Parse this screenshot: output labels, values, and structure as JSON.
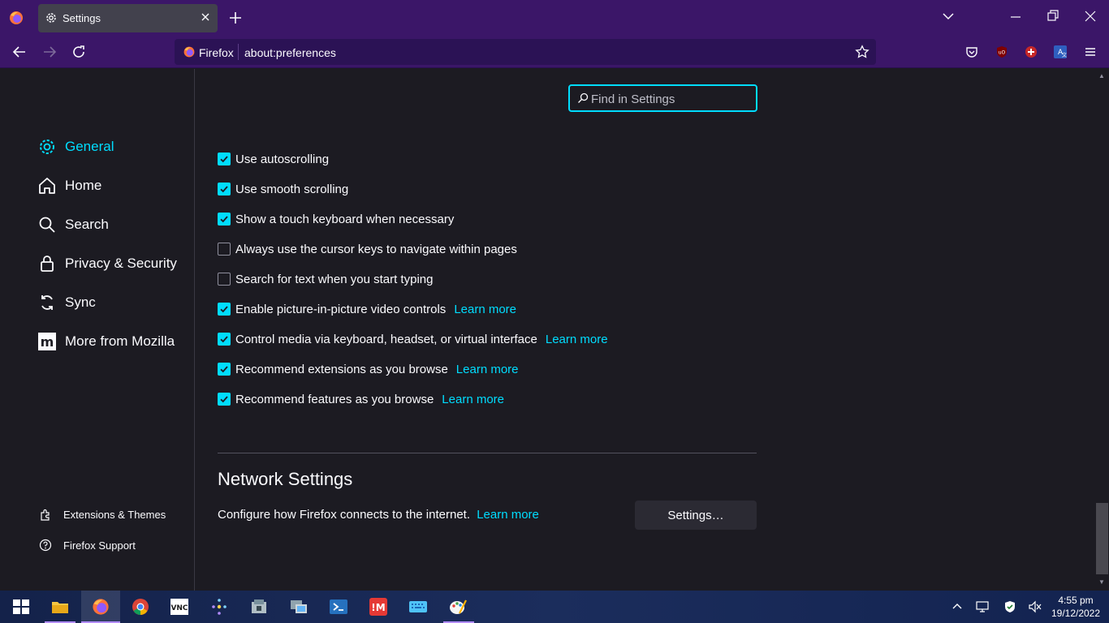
{
  "tab": {
    "title": "Settings"
  },
  "urlbar": {
    "identity": "Firefox",
    "url": "about:preferences"
  },
  "search": {
    "placeholder": "Find in Settings"
  },
  "sidebar": {
    "categories": [
      {
        "label": "General",
        "icon": "gear-icon",
        "active": true
      },
      {
        "label": "Home",
        "icon": "home-icon"
      },
      {
        "label": "Search",
        "icon": "search-icon"
      },
      {
        "label": "Privacy & Security",
        "icon": "lock-icon"
      },
      {
        "label": "Sync",
        "icon": "sync-icon"
      },
      {
        "label": "More from Mozilla",
        "icon": "mozilla-icon"
      }
    ],
    "footer": [
      {
        "label": "Extensions & Themes",
        "icon": "puzzle-icon"
      },
      {
        "label": "Firefox Support",
        "icon": "help-icon"
      }
    ]
  },
  "options": [
    {
      "label": "Use autoscrolling",
      "checked": true
    },
    {
      "label": "Use smooth scrolling",
      "checked": true
    },
    {
      "label": "Show a touch keyboard when necessary",
      "checked": true
    },
    {
      "label": "Always use the cursor keys to navigate within pages",
      "checked": false
    },
    {
      "label": "Search for text when you start typing",
      "checked": false
    },
    {
      "label": "Enable picture-in-picture video controls",
      "checked": true,
      "learn": "Learn more"
    },
    {
      "label": "Control media via keyboard, headset, or virtual interface",
      "checked": true,
      "learn": "Learn more"
    },
    {
      "label": "Recommend extensions as you browse",
      "checked": true,
      "learn": "Learn more"
    },
    {
      "label": "Recommend features as you browse",
      "checked": true,
      "learn": "Learn more"
    }
  ],
  "network": {
    "title": "Network Settings",
    "description": "Configure how Firefox connects to the internet.",
    "learn": "Learn more",
    "button": "Settings…"
  },
  "clock": {
    "time": "4:55 pm",
    "date": "19/12/2022"
  },
  "colors": {
    "accent": "#00ddff",
    "chrome": "#3b1668",
    "content_bg": "#1c1b22"
  }
}
